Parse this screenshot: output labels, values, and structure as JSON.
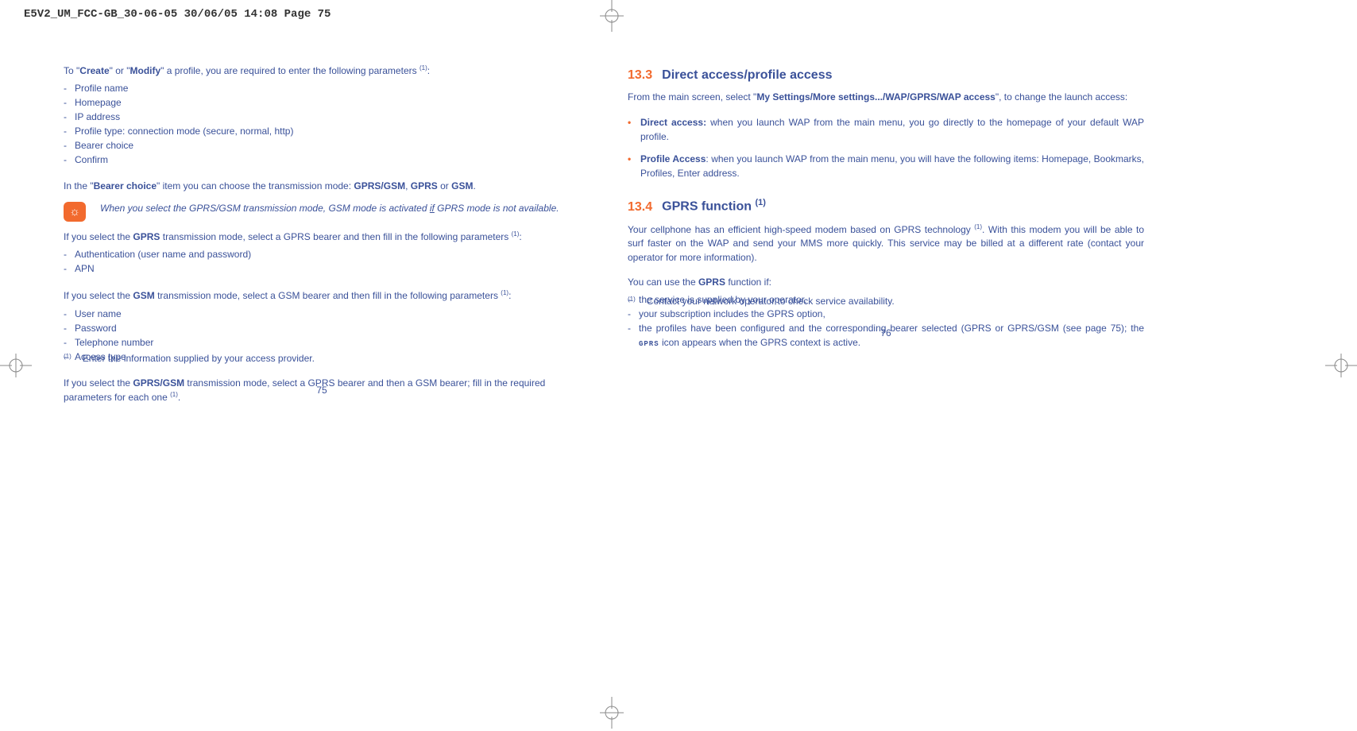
{
  "header": "E5V2_UM_FCC-GB_30-06-05  30/06/05  14:08  Page 75",
  "left": {
    "intro_pre": "To \"",
    "intro_b1": "Create",
    "intro_mid": "\" or \"",
    "intro_b2": "Modify",
    "intro_post": "\" a profile, you are required to enter the following parameters ",
    "sup1": "(1)",
    "colon": ":",
    "params": [
      "Profile name",
      "Homepage",
      "IP address",
      "Profile type: connection mode (secure, normal, http)",
      "Bearer choice",
      "Confirm"
    ],
    "bearer_pre": "In the \"",
    "bearer_b": "Bearer choice",
    "bearer_mid": "\" item you can choose the transmission mode: ",
    "bearer_m1": "GPRS/GSM",
    "bearer_c1": ", ",
    "bearer_m2": "GPRS",
    "bearer_c2": " or ",
    "bearer_m3": "GSM",
    "bearer_end": ".",
    "tip": "When you select the GPRS/GSM transmission mode, GSM mode is activated ",
    "tip_if": "if",
    "tip2": " GPRS mode is not available.",
    "gprs_pre": "If you select the ",
    "gprs_b": "GPRS",
    "gprs_post": " transmission mode, select a GPRS bearer and then fill in the following parameters ",
    "gprs_sup": "(1)",
    "gprs_colon": ":",
    "gprs_params": [
      "Authentication (user name and password)",
      "APN"
    ],
    "gsm_pre": "If you select the ",
    "gsm_b": "GSM",
    "gsm_post": " transmission mode, select a GSM bearer and then fill in the following parameters ",
    "gsm_sup": "(1)",
    "gsm_colon": ":",
    "gsm_params": [
      "User name",
      "Password",
      "Telephone number",
      "Access type"
    ],
    "gprsgsm_pre": "If you select the ",
    "gprsgsm_b": "GPRS/GSM",
    "gprsgsm_post": " transmission mode, select a GPRS bearer and then a GSM bearer; fill in the required parameters for each one ",
    "gprsgsm_sup": "(1)",
    "gprsgsm_end": ".",
    "footnote_mark": "(1)",
    "footnote": "Enter the information supplied by your access provider.",
    "pagenum": "75"
  },
  "right": {
    "s133_num": "13.3",
    "s133_title": "Direct access/profile access",
    "s133_intro_pre": "From the main screen, select \"",
    "s133_intro_b": "My Settings/More settings.../WAP/GPRS/WAP access",
    "s133_intro_post": "\", to change the launch access:",
    "bullets": [
      {
        "b": "Direct access:",
        "t": " when you launch WAP from the main menu, you go directly to the homepage of your default WAP profile."
      },
      {
        "b": "Profile Access",
        "t": ": when you launch WAP from the main menu, you will have the following items: Homepage, Bookmarks, Profiles, Enter address."
      }
    ],
    "s134_num": "13.4",
    "s134_title": "GPRS function ",
    "s134_sup": "(1)",
    "s134_p1_pre": "Your cellphone has an efficient high-speed modem based on GPRS technology ",
    "s134_p1_sup": "(1)",
    "s134_p1_post": ". With this modem you will be able to surf faster on the WAP and send your MMS more quickly. This service may be billed at a different rate (contact your operator for more information).",
    "s134_p2_pre": "You can use the ",
    "s134_p2_b": "GPRS",
    "s134_p2_post": " function if:",
    "s134_list": [
      "the service is supplied by your operator,",
      "your subscription includes the GPRS option,"
    ],
    "s134_list3_a": "the profiles have been configured and the corresponding bearer selected (GPRS or GPRS/GSM (see page 75); the ",
    "s134_list3_tag": "GPRS",
    "s134_list3_b": " icon appears when the GPRS context is active.",
    "footnote_mark": "(1)",
    "footnote": "Contact your network operator to check service availability.",
    "pagenum": "76"
  }
}
